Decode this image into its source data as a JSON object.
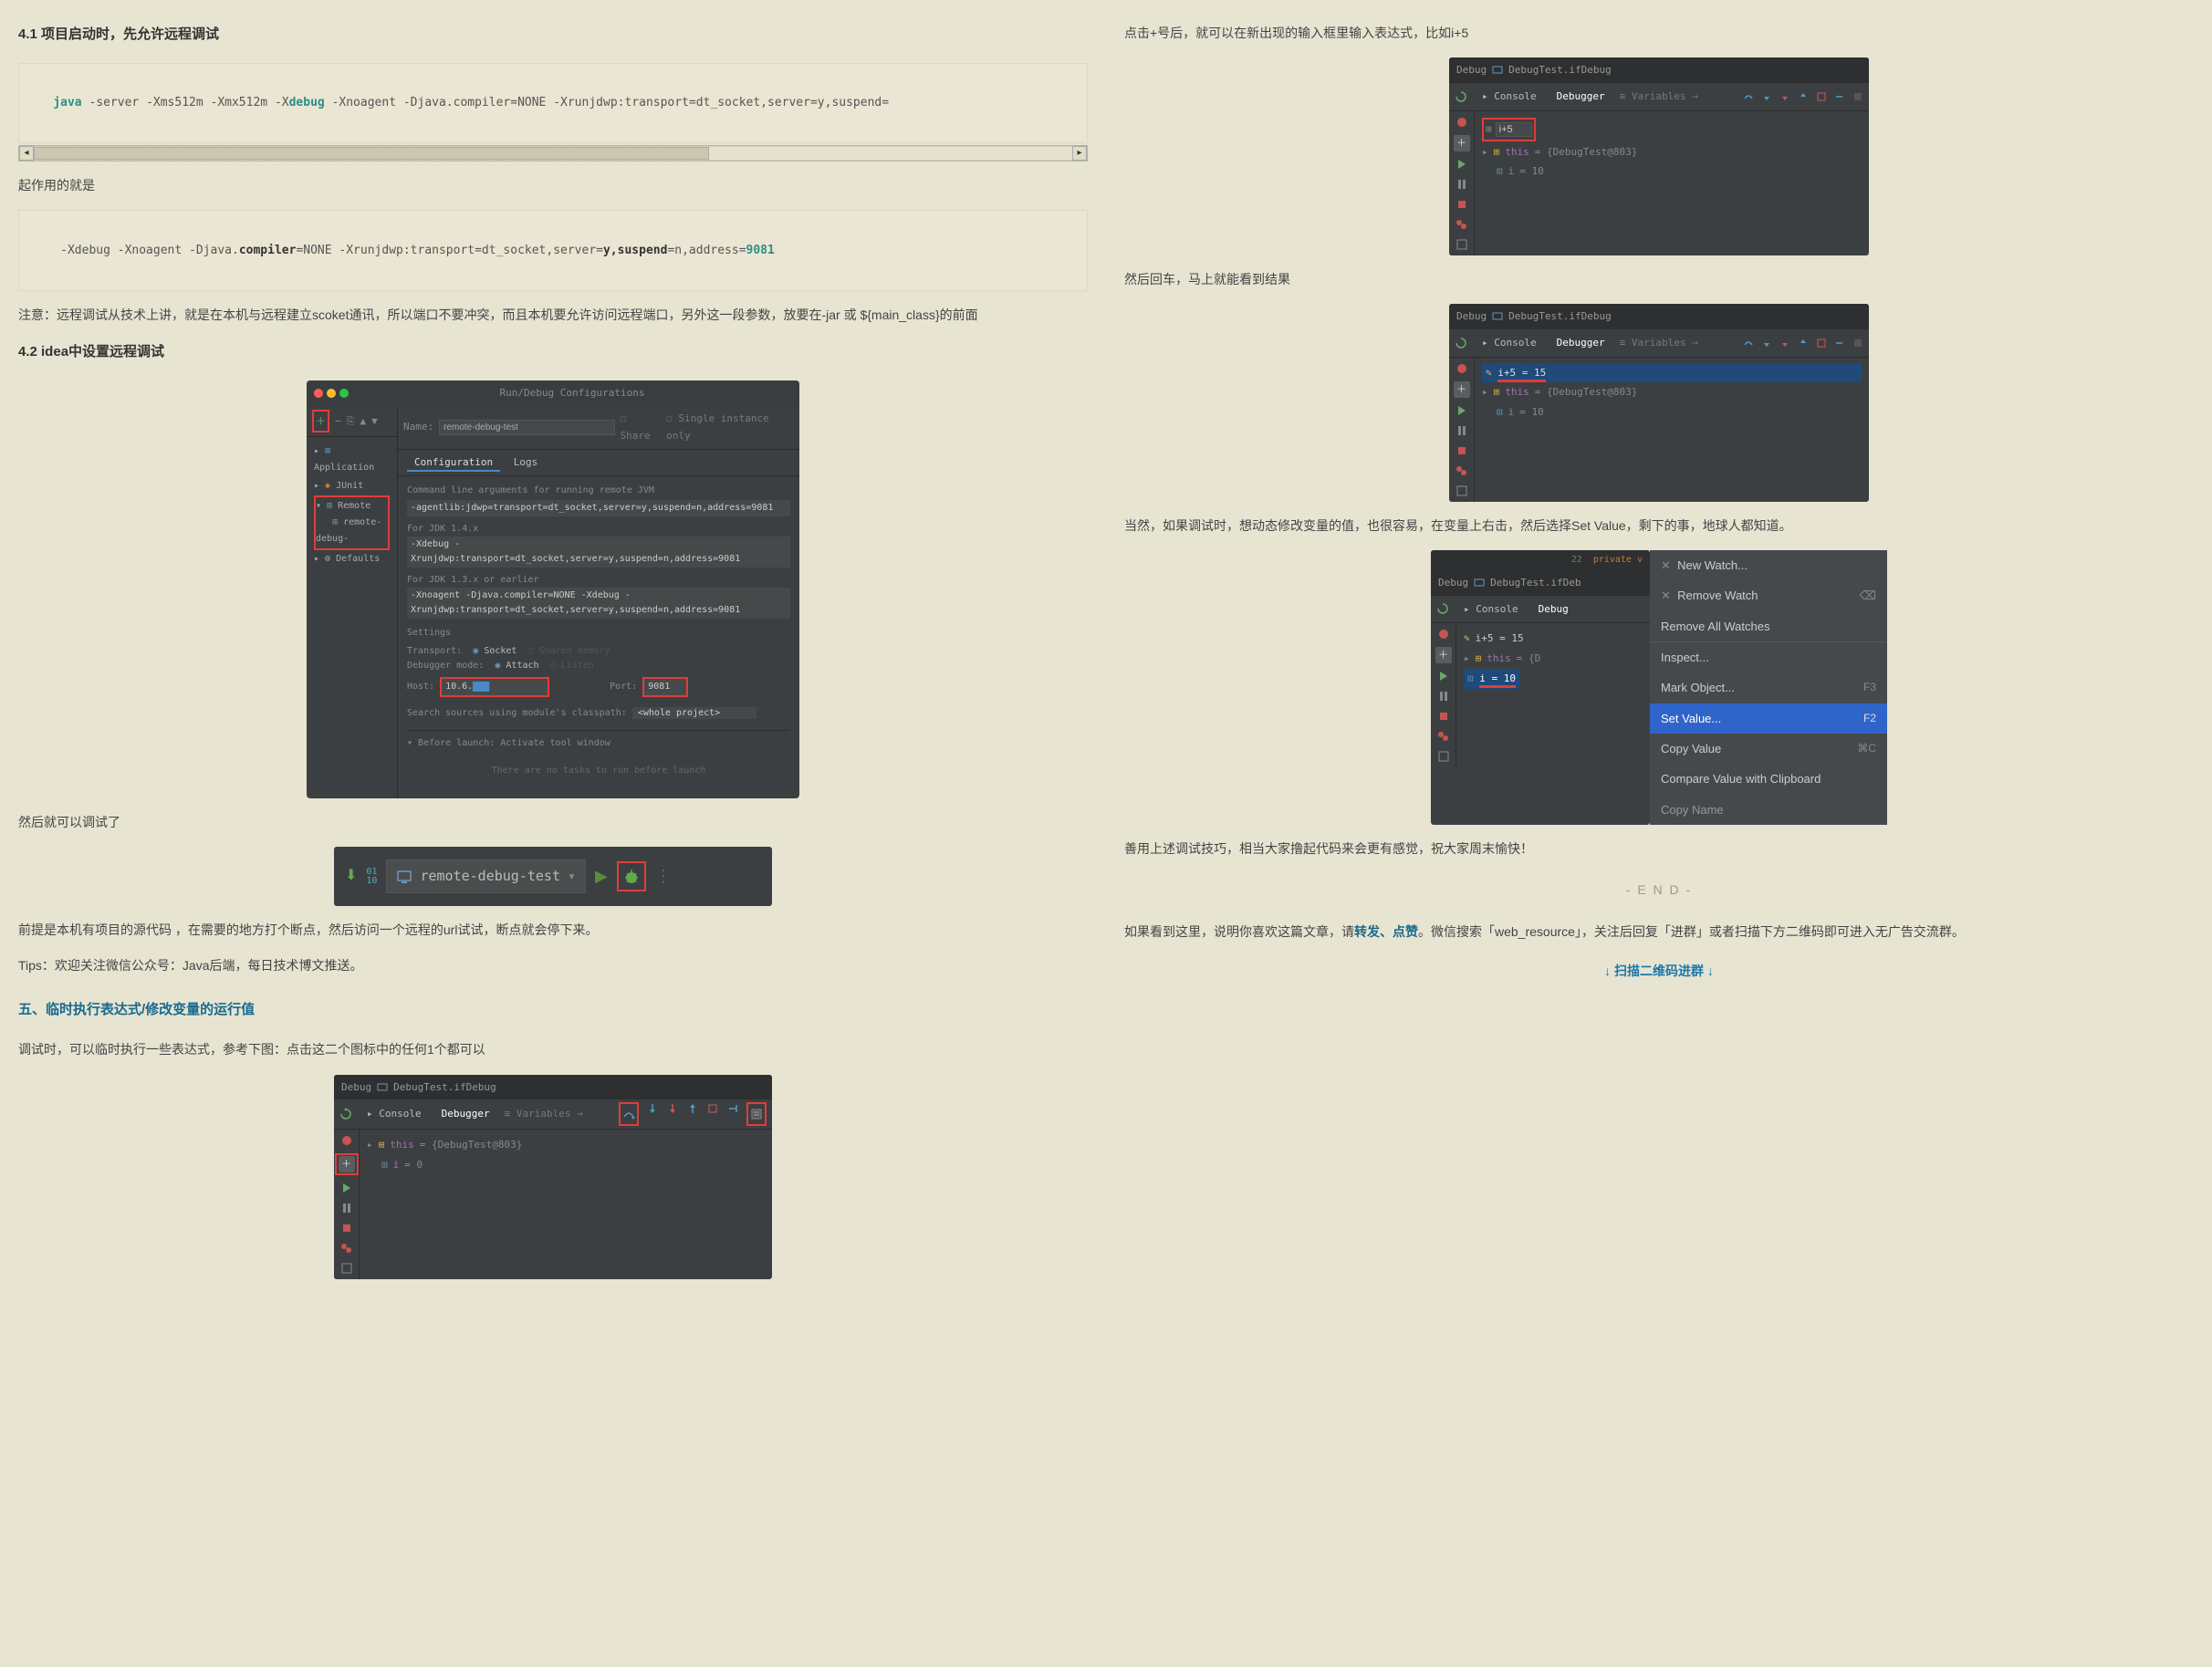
{
  "s41": {
    "title": "4.1 项目启动时，先允许远程调试",
    "code1_pre": "java",
    "code1_mid": " -server -Xms512m -Xmx512m -X",
    "code1_debug": "debug",
    "code1_post": " -Xnoagent -Djava.compiler=NONE -Xrunjdwp:transport=dt_socket,server=y,suspend=",
    "p1": "起作用的就是",
    "code2_pre": " -Xdebug -Xnoagent -Djava.",
    "code2_b1": "compiler",
    "code2_mid": "=NONE -Xrunjdwp:transport=dt_socket,server=",
    "code2_b2": "y,suspend",
    "code2_post": "=n,address=",
    "code2_port": "9081",
    "p2": "注意：远程调试从技术上讲，就是在本机与远程建立scoket通讯，所以端口不要冲突，而且本机要允许访问远程端口，另外这一段参数，放要在-jar 或 ${main_class}的前面"
  },
  "s42": {
    "title": "4.2 idea中设置远程调试",
    "cfg_title": "Run/Debug Configurations",
    "name_lbl": "Name:",
    "name_val": "remote-debug-test",
    "share": "Share",
    "single": "Single instance only",
    "tree_app": "Application",
    "tree_junit": "JUnit",
    "tree_remote": "Remote",
    "tree_remote_item": "remote-debug-",
    "tree_defaults": "Defaults",
    "tab_cfg": "Configuration",
    "tab_logs": "Logs",
    "cmdline": "Command line arguments for running remote JVM",
    "agentlib": "-agentlib:jdwp=transport=dt_socket,server=y,suspend=n,address=9081",
    "jdk14": "For JDK 1.4.x",
    "jdk14_cmd": "-Xdebug -Xrunjdwp:transport=dt_socket,server=y,suspend=n,address=9081",
    "jdk13": "For JDK 1.3.x or earlier",
    "jdk13_cmd": "-Xnoagent -Djava.compiler=NONE -Xdebug -Xrunjdwp:transport=dt_socket,server=y,suspend=n,address=9081",
    "settings": "Settings",
    "transport": "Transport:",
    "socket": "Socket",
    "shared": "Shared memory",
    "dbgmode": "Debugger mode:",
    "attach": "Attach",
    "listen": "Listen",
    "host": "Host:",
    "host_val": "10.6.",
    "port": "Port:",
    "port_val": "9081",
    "search": "Search sources using module's classpath:",
    "whole": "<whole project>",
    "before": "Before launch: Activate tool window",
    "tasks": "There are no tasks to run before launch"
  },
  "after_cfg": "然后就可以调试了",
  "rdbar": {
    "digits1": "01",
    "digits2": "10",
    "label": "remote-debug-test"
  },
  "p3": "前提是本机有项目的源代码 ，在需要的地方打个断点，然后访问一个远程的url试试，断点就会停下来。",
  "tips": "Tips：欢迎关注微信公众号：Java后端，每日技术博文推送。",
  "sec5_title": "五、临时执行表达式/修改变量的运行值",
  "sec5_p1": "调试时，可以临时执行一些表达式，参考下图：点击这二个图标中的任何1个都可以",
  "dbg": {
    "title_pre": "Debug",
    "title": "DebugTest.ifDebug",
    "tab_console": "Console",
    "tab_debugger": "Debugger",
    "variables": "Variables",
    "this_label": "this",
    "this_val": "= {DebugTest@803}",
    "i_label": "i",
    "i_val": "= 0",
    "i_val_10": "= 10",
    "expr": "i+5",
    "expr_result": "i+5 = 15"
  },
  "right": {
    "p1": "点击+号后，就可以在新出现的输入框里输入表达式，比如i+5",
    "p2": "然后回车，马上就能看到结果",
    "p3": "当然，如果调试时，想动态修改变量的值，也很容易，在变量上右击，然后选择Set Value，剩下的事，地球人都知道。",
    "p4": "善用上述调试技巧，相当大家撸起代码来会更有感觉，祝大家周末愉快！",
    "end": "- E N D -",
    "p5_a": "如果看到这里，说明你喜欢这篇文章，请",
    "p5_link": "转发、点赞",
    "p5_b": "。微信搜索「web_resource」，关注后回复「进群」或者扫描下方二维码即可进入无广告交流群。",
    "qr": "↓ 扫描二维码进群 ↓"
  },
  "ctx": {
    "new_watch": "New Watch...",
    "remove_watch": "Remove Watch",
    "remove_all": "Remove All Watches",
    "inspect": "Inspect...",
    "mark": "Mark Object...",
    "mark_sc": "F3",
    "set_value": "Set Value...",
    "set_value_sc": "F2",
    "copy_value": "Copy Value",
    "copy_value_sc": "⌘C",
    "compare": "Compare Value with Clipboard",
    "copy_name": "Copy Name",
    "code_hint": "private v"
  }
}
